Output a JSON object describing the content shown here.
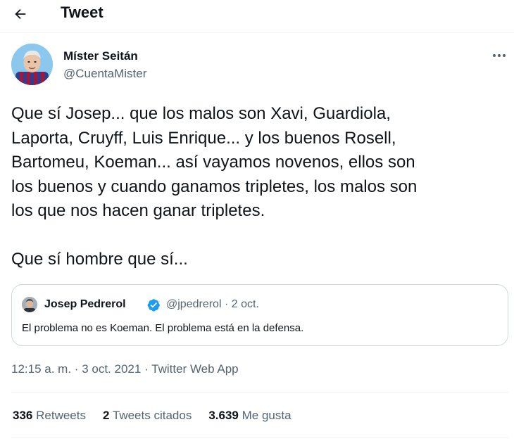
{
  "header": {
    "title": "Tweet"
  },
  "tweet": {
    "author": {
      "display_name": "Míster Seitán",
      "handle": "@CuentaMister"
    },
    "text": "Que sí Josep... que los malos son Xavi, Guardiola,\nLaporta, Cruyff, Luis Enrique... y los buenos Rosell,\nBartomeu, Koeman... así vayamos novenos, ellos son\nlos buenos y cuando ganamos tripletes, los malos son\nlos que nos hacen ganar tripletes.\n\nQue sí hombre que sí...",
    "quote": {
      "display_name": "Josep Pedrerol",
      "handle": "@jpedrerol",
      "separator": "·",
      "date": "2 oct.",
      "text": "El problema no es Koeman. El problema está en la defensa."
    },
    "timestamp": {
      "time": "12:15 a. m.",
      "separator1": "·",
      "date": "3 oct. 2021",
      "separator2": "·",
      "source": "Twitter Web App"
    },
    "stats": {
      "retweets_count": "336",
      "retweets_label": "Retweets",
      "quotes_count": "2",
      "quotes_label": "Tweets citados",
      "likes_count": "3.639",
      "likes_label": "Me gusta"
    }
  },
  "icons": {
    "back": "arrow-left-icon",
    "more": "more-horizontal-icon",
    "verified": "verified-badge-icon"
  },
  "colors": {
    "text_primary": "#0f1419",
    "text_secondary": "#536471",
    "border": "#cfd9de",
    "divider": "#eff3f4",
    "verified_blue": "#1d9bf0"
  }
}
